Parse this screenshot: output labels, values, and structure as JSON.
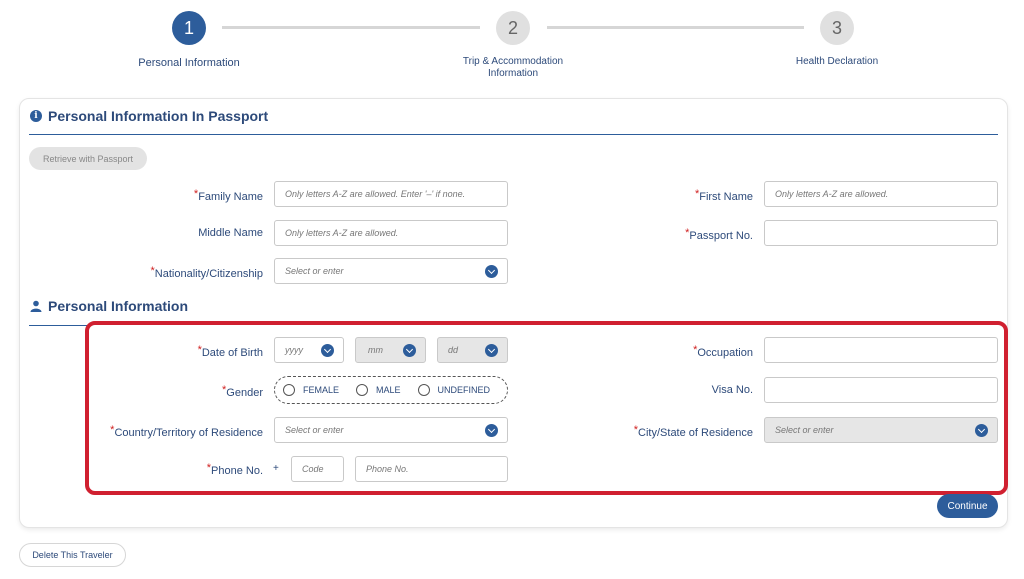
{
  "steps": [
    {
      "number": "1",
      "label": "Personal Information"
    },
    {
      "number": "2",
      "label": "Trip & Accommodation Information"
    },
    {
      "number": "3",
      "label": "Health Declaration"
    }
  ],
  "passport_section": {
    "title": "Personal Information In Passport",
    "retrieve_button": "Retrieve with Passport",
    "family_name": {
      "label": "Family Name",
      "placeholder": "Only letters A-Z are allowed. Enter '–' if none."
    },
    "first_name": {
      "label": "First Name",
      "placeholder": "Only letters A-Z are allowed."
    },
    "middle_name": {
      "label": "Middle Name",
      "placeholder": "Only letters A-Z are allowed."
    },
    "passport_no": {
      "label": "Passport No.",
      "placeholder": ""
    },
    "nationality": {
      "label": "Nationality/Citizenship",
      "placeholder": "Select or enter"
    }
  },
  "personal_section": {
    "title": "Personal Information",
    "dob": {
      "label": "Date of Birth",
      "yyyy": "yyyy",
      "mm": "mm",
      "dd": "dd"
    },
    "occupation": {
      "label": "Occupation"
    },
    "gender": {
      "label": "Gender",
      "options": [
        "FEMALE",
        "MALE",
        "UNDEFINED"
      ]
    },
    "visa_no": {
      "label": "Visa No."
    },
    "country": {
      "label": "Country/Territory of Residence",
      "placeholder": "Select or enter"
    },
    "city": {
      "label": "City/State of Residence",
      "placeholder": "Select or enter"
    },
    "phone": {
      "label": "Phone No.",
      "plus": "+",
      "code_placeholder": "Code",
      "number_placeholder": "Phone No."
    }
  },
  "continue_button": "Continue",
  "delete_button": "Delete This Traveler",
  "colors": {
    "accent": "#2d5d9b",
    "required": "#d02020",
    "highlight": "#d02030"
  }
}
